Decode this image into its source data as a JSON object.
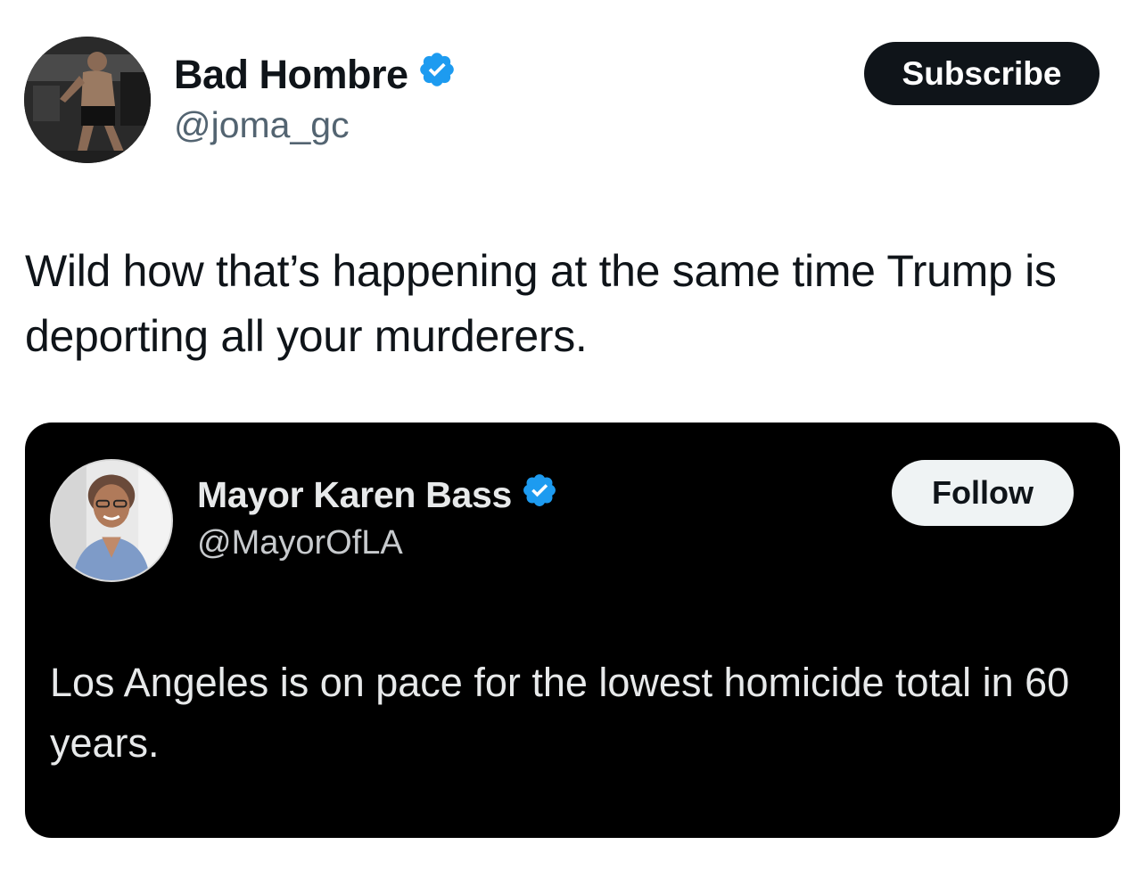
{
  "post": {
    "author": {
      "name": "Bad Hombre",
      "handle": "@joma_gc",
      "verified": true
    },
    "subscribe_label": "Subscribe",
    "text": "Wild how that’s happening at the same time Trump is deporting all your murderers."
  },
  "quoted_post": {
    "author": {
      "name": "Mayor Karen Bass",
      "handle": "@MayorOfLA",
      "verified": true
    },
    "follow_label": "Follow",
    "text": "Los Angeles is on pace for the lowest homicide total in 60 years."
  },
  "icons": {
    "avatar_main": "user-avatar",
    "avatar_quote": "user-avatar",
    "verified": "verified-badge-icon"
  },
  "colors": {
    "verified_blue": "#1d9bf0",
    "text_primary": "#0f1419",
    "text_secondary": "#536471",
    "quote_bg": "#000000"
  }
}
